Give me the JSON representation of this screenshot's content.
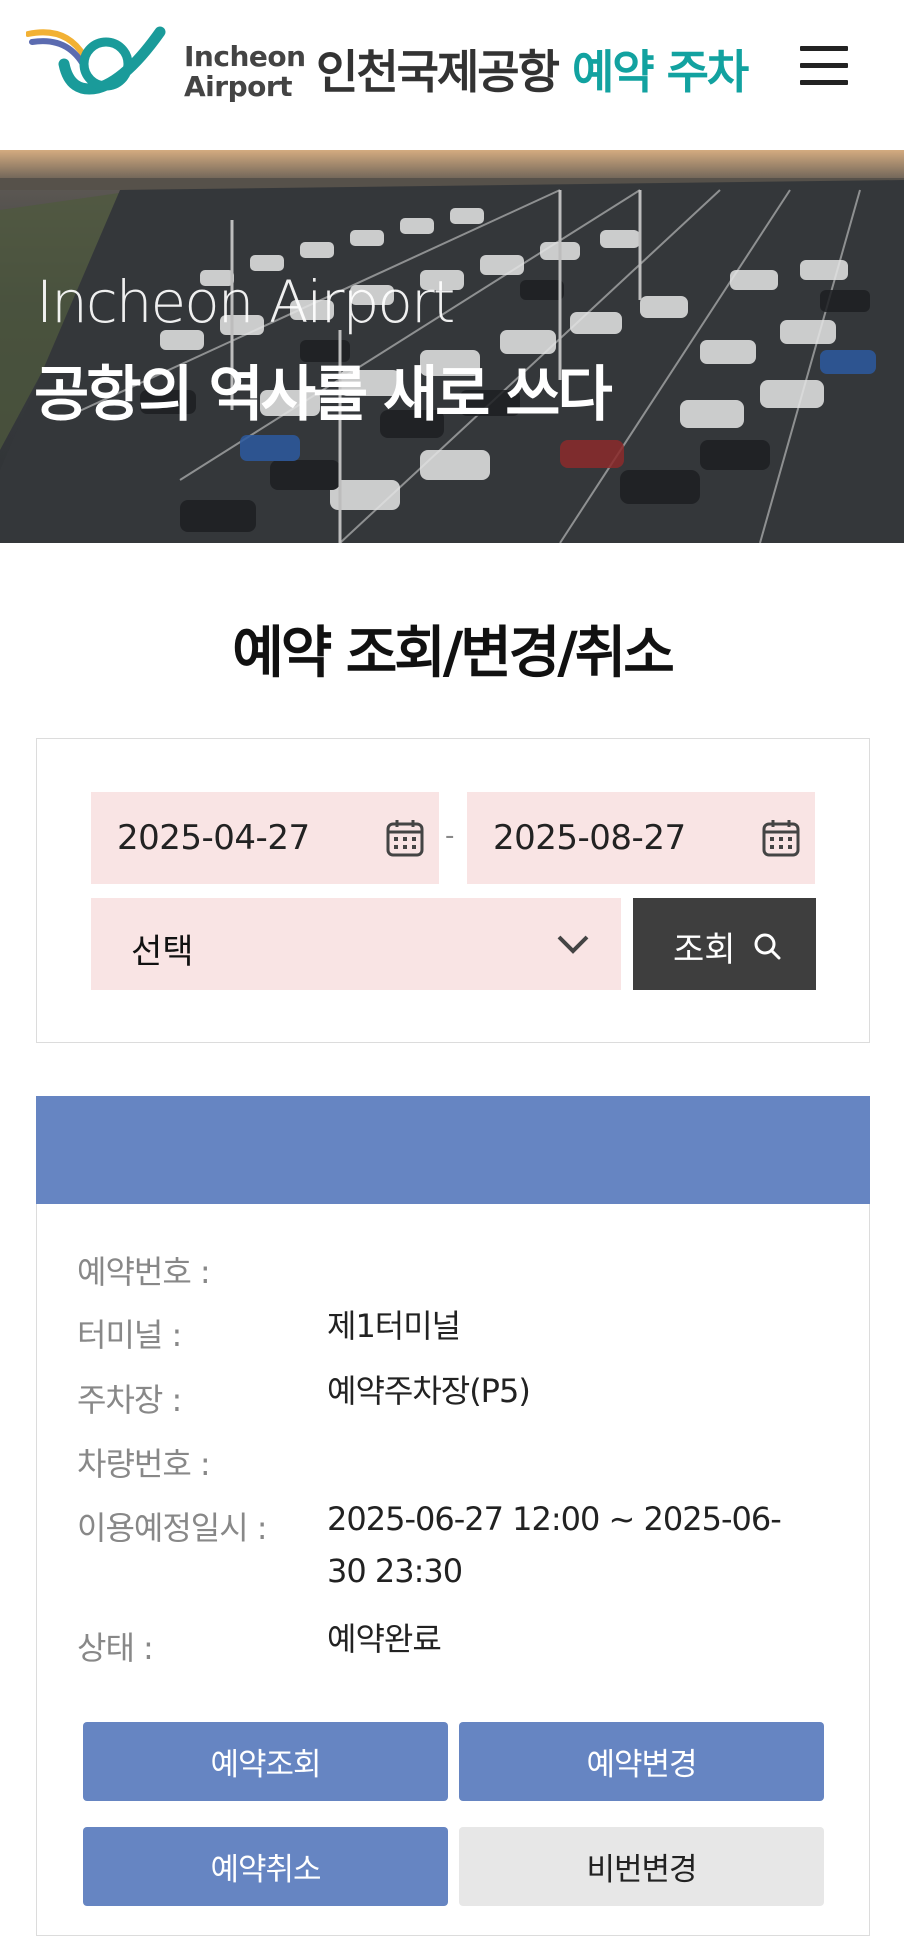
{
  "header": {
    "logo_line1": "Incheon",
    "logo_line2": "Airport",
    "title_main": "인천국제공항",
    "title_accent": "예약 주차",
    "menu_icon": "hamburger-menu-icon"
  },
  "hero": {
    "title_en": "Incheon Airport",
    "title_ko": "공항의 역사를 새로 쓰다"
  },
  "page": {
    "title": "예약 조회/변경/취소"
  },
  "search": {
    "start_date": "2025-04-27",
    "end_date": "2025-08-27",
    "separator": "-",
    "select_value": "선택",
    "button_label": "조회",
    "calendar_icon": "calendar-icon",
    "search_icon": "search-icon"
  },
  "result": {
    "rows": [
      {
        "label": "예약번호 :",
        "value": ""
      },
      {
        "label": "터미널 :",
        "value": "제1터미널"
      },
      {
        "label": "주차장 :",
        "value": "예약주차장(P5)"
      },
      {
        "label": "차량번호 :",
        "value": ""
      },
      {
        "label": "이용예정일시 :",
        "value": "2025-06-27 12:00 ~ 2025-06-30 23:30"
      },
      {
        "label": "상태 :",
        "value": "예약완료"
      }
    ],
    "buttons": {
      "inquiry": "예약조회",
      "change": "예약변경",
      "cancel": "예약취소",
      "password": "비번변경"
    }
  },
  "colors": {
    "accent_teal": "#12a2a0",
    "input_bg": "#f9e4e4",
    "primary_blue": "#6685c2",
    "dark_button": "#3e3e3e"
  }
}
